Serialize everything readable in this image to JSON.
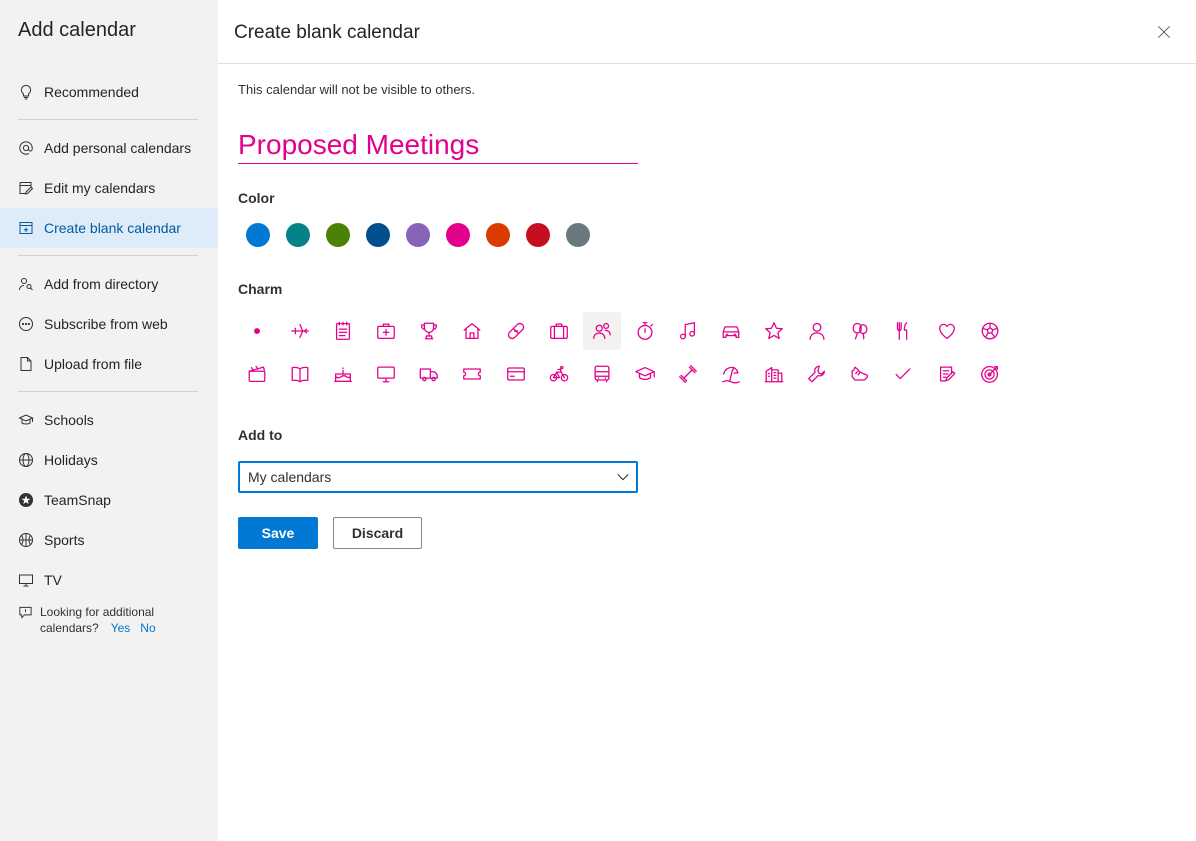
{
  "sidebar": {
    "title": "Add calendar",
    "items": [
      {
        "label": "Recommended",
        "icon": "lightbulb-icon"
      },
      {
        "label": "Add personal calendars",
        "icon": "at-sign-icon"
      },
      {
        "label": "Edit my calendars",
        "icon": "calendar-edit-icon"
      },
      {
        "label": "Create blank calendar",
        "icon": "calendar-add-icon",
        "active": true
      },
      {
        "label": "Add from directory",
        "icon": "people-search-icon"
      },
      {
        "label": "Subscribe from web",
        "icon": "globe-link-icon"
      },
      {
        "label": "Upload from file",
        "icon": "document-icon"
      },
      {
        "label": "Schools",
        "icon": "school-icon"
      },
      {
        "label": "Holidays",
        "icon": "globe-icon"
      },
      {
        "label": "TeamSnap",
        "icon": "teamsnap-icon"
      },
      {
        "label": "Sports",
        "icon": "basketball-icon"
      },
      {
        "label": "TV",
        "icon": "tv-icon"
      }
    ],
    "feedback": {
      "text_line1": "Looking for additional",
      "text_line2": "calendars?",
      "yes": "Yes",
      "no": "No"
    }
  },
  "main": {
    "title": "Create blank calendar",
    "note": "This calendar will not be visible to others.",
    "calendar_name": "Proposed Meetings",
    "color_label": "Color",
    "colors": [
      "#0078d4",
      "#038387",
      "#498205",
      "#004e8c",
      "#8764b8",
      "#e3008c",
      "#da3b01",
      "#c50f1f",
      "#69797e"
    ],
    "selected_color": "#e3008c",
    "charm_label": "Charm",
    "charms_row1": [
      "dot-icon",
      "airplane-icon",
      "notepad-icon",
      "first-aid-icon",
      "trophy-icon",
      "home-icon",
      "bandage-icon",
      "briefcase-icon",
      "people-icon",
      "stopwatch-icon",
      "music-note-icon",
      "car-icon",
      "star-icon",
      "person-icon",
      "balloons-icon",
      "fork-knife-icon",
      "heart-icon",
      "soccer-ball-icon"
    ],
    "charms_row2": [
      "clapperboard-icon",
      "book-icon",
      "birthday-cake-icon",
      "monitor-icon",
      "truck-icon",
      "ticket-icon",
      "credit-card-icon",
      "bicycle-icon",
      "bus-icon",
      "graduation-cap-icon",
      "dumbbell-icon",
      "beach-icon",
      "city-icon",
      "wrench-icon",
      "sneaker-icon",
      "checkmark-icon",
      "note-edit-icon",
      "target-icon"
    ],
    "selected_charm": "people-icon",
    "add_to_label": "Add to",
    "add_to_value": "My calendars",
    "save_label": "Save",
    "discard_label": "Discard"
  }
}
